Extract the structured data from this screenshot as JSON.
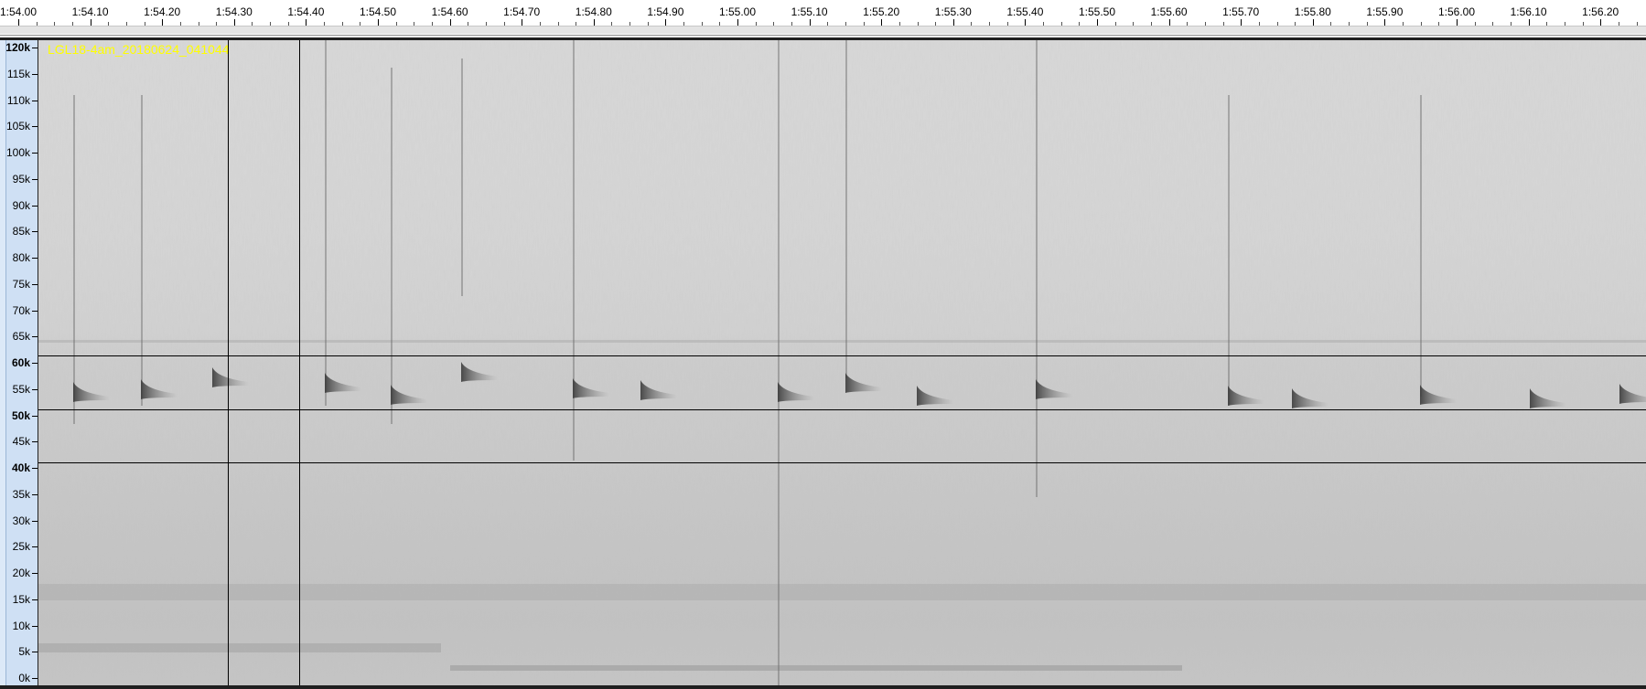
{
  "timeline": {
    "labels": [
      "1:54.00",
      "1:54.10",
      "1:54.20",
      "1:54.30",
      "1:54.40",
      "1:54.50",
      "1:54.60",
      "1:54.70",
      "1:54.80",
      "1:54.90",
      "1:55.00",
      "1:55.10",
      "1:55.20",
      "1:55.30",
      "1:55.40",
      "1:55.50",
      "1:55.60",
      "1:55.70",
      "1:55.80",
      "1:55.90",
      "1:56.00",
      "1:56.10",
      "1:56.20"
    ]
  },
  "track": {
    "name": "LGL18-4am_20180624_041044"
  },
  "frequency_axis": {
    "labels": [
      "120k",
      "115k",
      "110k",
      "105k",
      "100k",
      "95k",
      "90k",
      "85k",
      "80k",
      "75k",
      "70k",
      "65k",
      "60k",
      "55k",
      "50k",
      "45k",
      "40k",
      "35k",
      "30k",
      "25k",
      "20k",
      "15k",
      "10k",
      "5k",
      "0k"
    ],
    "bold_labels": [
      "120k",
      "60k",
      "50k",
      "40k"
    ]
  },
  "selection": {
    "start": "1:54.30",
    "end": "1:54.40",
    "low_freq": "40k",
    "high_freq": "60k",
    "center_freq": "50k"
  },
  "colors": {
    "track_name": "#ffff00",
    "ruler_background": "#cfe0f4"
  }
}
